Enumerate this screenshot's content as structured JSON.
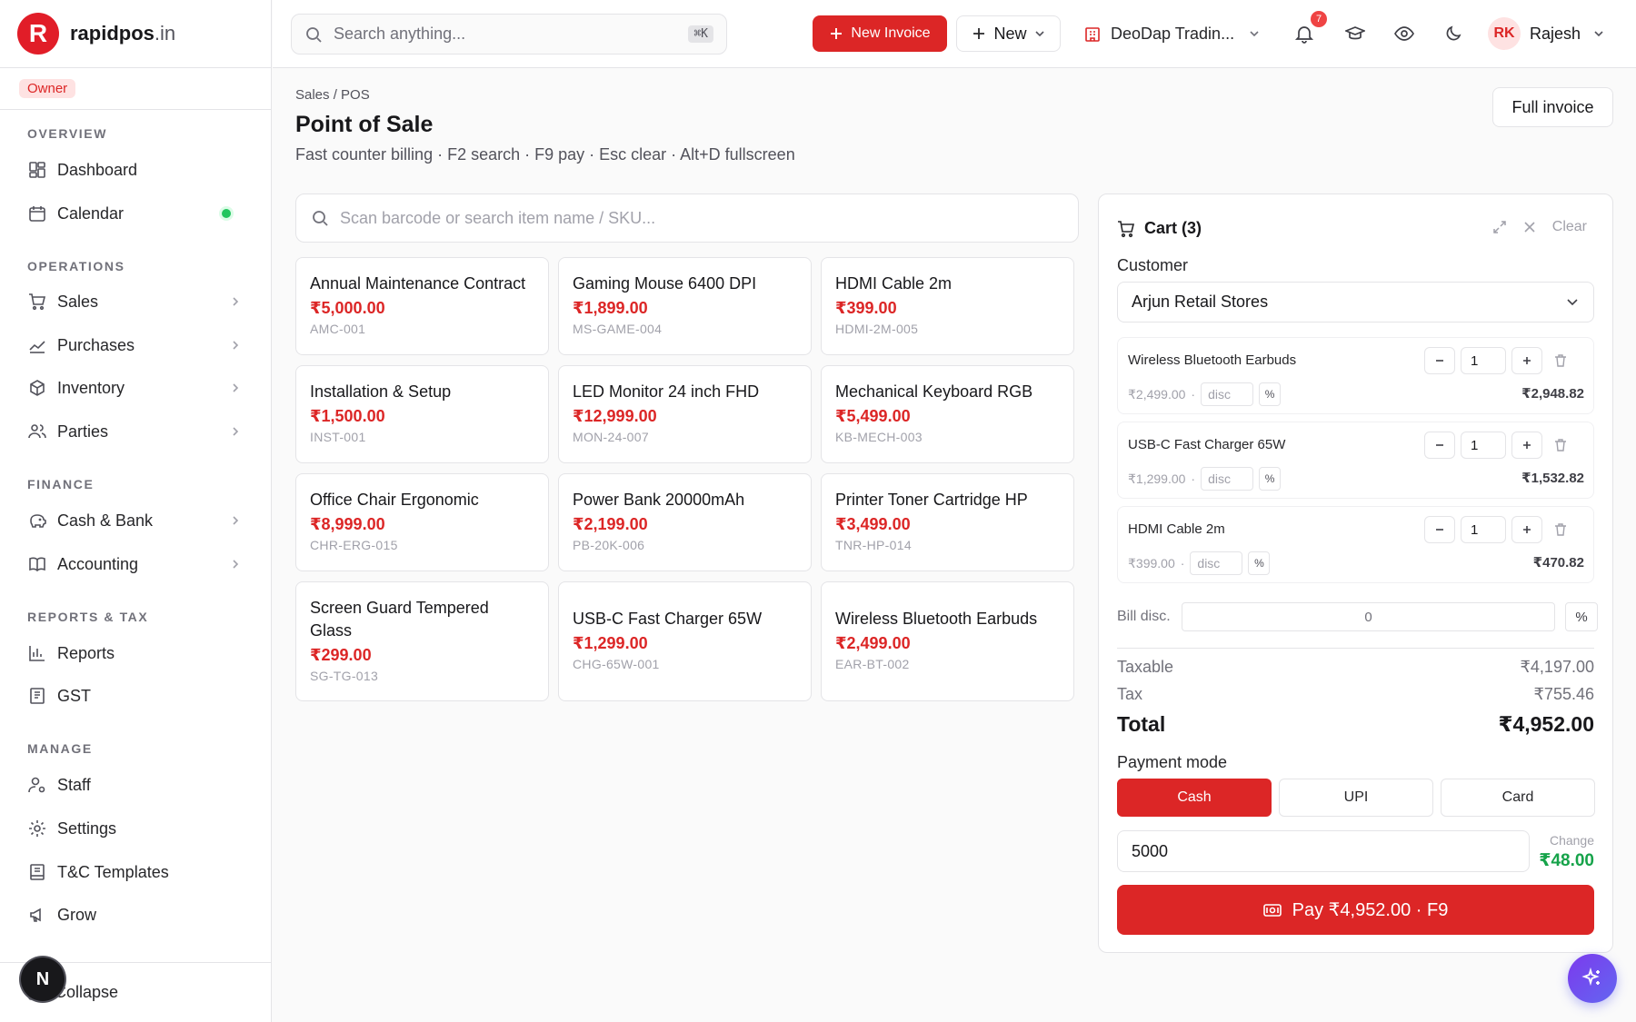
{
  "brand": {
    "logo_letter": "R",
    "name": "rapidpos",
    "tld": ".in",
    "accent": "#dc2626"
  },
  "sidebar": {
    "role": "Owner",
    "sections": {
      "overview": "OVERVIEW",
      "operations": "OPERATIONS",
      "finance": "FINANCE",
      "reports": "REPORTS & TAX",
      "manage": "MANAGE"
    },
    "items": {
      "dashboard": "Dashboard",
      "calendar": "Calendar",
      "sales": "Sales",
      "purchases": "Purchases",
      "inventory": "Inventory",
      "parties": "Parties",
      "cash_bank": "Cash & Bank",
      "accounting": "Accounting",
      "reports": "Reports",
      "gst": "GST",
      "staff": "Staff",
      "settings": "Settings",
      "tc_templates": "T&C Templates",
      "grow": "Grow"
    },
    "collapse": "Collapse",
    "dev_badge": "N"
  },
  "topbar": {
    "search_placeholder": "Search anything...",
    "search_shortcut": "⌘K",
    "new_invoice": "New Invoice",
    "new": "New",
    "company": "DeoDap Tradin...",
    "notifications_count": "7",
    "user_initials": "RK",
    "user_name": "Rajesh"
  },
  "page": {
    "breadcrumb": "Sales / POS",
    "title": "Point of Sale",
    "subtitle": "Fast counter billing · F2 search · F9 pay · Esc clear · Alt+D fullscreen",
    "full_invoice": "Full invoice",
    "item_search_placeholder": "Scan barcode or search item name / SKU..."
  },
  "products": [
    {
      "name": "Annual Maintenance Contract",
      "price": "₹5,000.00",
      "sku": "AMC-001"
    },
    {
      "name": "Gaming Mouse 6400 DPI",
      "price": "₹1,899.00",
      "sku": "MS-GAME-004"
    },
    {
      "name": "HDMI Cable 2m",
      "price": "₹399.00",
      "sku": "HDMI-2M-005"
    },
    {
      "name": "Installation & Setup",
      "price": "₹1,500.00",
      "sku": "INST-001"
    },
    {
      "name": "LED Monitor 24 inch FHD",
      "price": "₹12,999.00",
      "sku": "MON-24-007"
    },
    {
      "name": "Mechanical Keyboard RGB",
      "price": "₹5,499.00",
      "sku": "KB-MECH-003"
    },
    {
      "name": "Office Chair Ergonomic",
      "price": "₹8,999.00",
      "sku": "CHR-ERG-015"
    },
    {
      "name": "Power Bank 20000mAh",
      "price": "₹2,199.00",
      "sku": "PB-20K-006"
    },
    {
      "name": "Printer Toner Cartridge HP",
      "price": "₹3,499.00",
      "sku": "TNR-HP-014"
    },
    {
      "name": "Screen Guard Tempered Glass",
      "price": "₹299.00",
      "sku": "SG-TG-013"
    },
    {
      "name": "USB-C Fast Charger 65W",
      "price": "₹1,299.00",
      "sku": "CHG-65W-001"
    },
    {
      "name": "Wireless Bluetooth Earbuds",
      "price": "₹2,499.00",
      "sku": "EAR-BT-002"
    }
  ],
  "cart": {
    "title": "Cart (3)",
    "clear": "Clear",
    "customer_label": "Customer",
    "customer": "Arjun Retail Stores",
    "lines": [
      {
        "name": "Wireless Bluetooth Earbuds",
        "qty": "1",
        "unit_price": "₹2,499.00",
        "disc_placeholder": "disc",
        "pct": "%",
        "total": "₹2,948.82"
      },
      {
        "name": "USB-C Fast Charger 65W",
        "qty": "1",
        "unit_price": "₹1,299.00",
        "disc_placeholder": "disc",
        "pct": "%",
        "total": "₹1,532.82"
      },
      {
        "name": "HDMI Cable 2m",
        "qty": "1",
        "unit_price": "₹399.00",
        "disc_placeholder": "disc",
        "pct": "%",
        "total": "₹470.82"
      }
    ],
    "bill_disc_label": "Bill disc.",
    "bill_disc_value": "0",
    "bill_disc_unit": "%",
    "taxable_label": "Taxable",
    "taxable": "₹4,197.00",
    "tax_label": "Tax",
    "tax": "₹755.46",
    "total_label": "Total",
    "total": "₹4,952.00",
    "payment_mode_label": "Payment mode",
    "payment_modes": [
      "Cash",
      "UPI",
      "Card"
    ],
    "payment_mode_selected": "Cash",
    "tendered": "5000",
    "change_label": "Change",
    "change": "₹48.00",
    "pay_button": "Pay ₹4,952.00 · F9"
  }
}
